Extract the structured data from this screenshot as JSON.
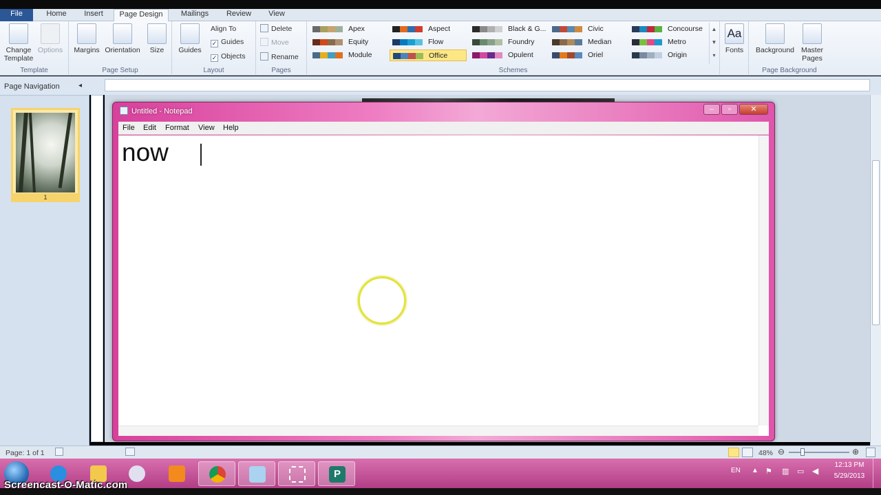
{
  "ribbon_tabs": [
    "File",
    "Home",
    "Insert",
    "Page Design",
    "Mailings",
    "Review",
    "View"
  ],
  "ribbon": {
    "template": {
      "change_template": "Change Template",
      "options": "Options",
      "label": "Template"
    },
    "page_setup": {
      "margins": "Margins",
      "orientation": "Orientation",
      "size": "Size",
      "label": "Page Setup"
    },
    "layout": {
      "guides": "Guides",
      "align_to": "Align To",
      "guides_check": "Guides",
      "objects_check": "Objects",
      "label": "Layout"
    },
    "pages": {
      "delete": "Delete",
      "move": "Move",
      "rename": "Rename",
      "label": "Pages"
    },
    "schemes": {
      "label": "Schemes",
      "items": [
        {
          "name": "Apex",
          "colors": [
            "#6a6a6a",
            "#a8a060",
            "#c9a36b",
            "#9fb09a"
          ]
        },
        {
          "name": "Aspect",
          "colors": [
            "#222222",
            "#e06a1f",
            "#2a6fb0",
            "#d33b2c"
          ]
        },
        {
          "name": "Black & G...",
          "colors": [
            "#2a2a2a",
            "#8a8a8a",
            "#b0b0b0",
            "#d0d0d0"
          ]
        },
        {
          "name": "Civic",
          "colors": [
            "#4a6a8a",
            "#c04a3a",
            "#5a8ab0",
            "#d08a40"
          ]
        },
        {
          "name": "Concourse",
          "colors": [
            "#2a3a5a",
            "#1a8ac0",
            "#c02a3a",
            "#5ab040"
          ]
        },
        {
          "name": "Equity",
          "colors": [
            "#6a2a1a",
            "#d04a1a",
            "#8a6a4a",
            "#b09070"
          ]
        },
        {
          "name": "Flow",
          "colors": [
            "#1a3a6a",
            "#0a7ac0",
            "#1aa0d0",
            "#5ac0e0"
          ]
        },
        {
          "name": "Foundry",
          "colors": [
            "#3a4a3a",
            "#6a8a6a",
            "#8aa08a",
            "#b0c0a0"
          ]
        },
        {
          "name": "Median",
          "colors": [
            "#4a3a2a",
            "#8a6a4a",
            "#b08a5a",
            "#5a7a9a"
          ]
        },
        {
          "name": "Metro",
          "colors": [
            "#2a2a3a",
            "#7ac040",
            "#e04a8a",
            "#1a9ad0"
          ]
        },
        {
          "name": "Module",
          "colors": [
            "#4a6a8a",
            "#e0b020",
            "#40a0c0",
            "#e07020"
          ]
        },
        {
          "name": "Office",
          "colors": [
            "#1f497d",
            "#4f81bd",
            "#c0504d",
            "#9bbb59"
          ]
        },
        {
          "name": "Opulent",
          "colors": [
            "#8a1a6a",
            "#d04aa0",
            "#6a2a8a",
            "#e08ac0"
          ]
        },
        {
          "name": "Oriel",
          "colors": [
            "#3a4a6a",
            "#e07a20",
            "#a04a2a",
            "#5a8ac0"
          ]
        },
        {
          "name": "Origin",
          "colors": [
            "#2a3a4a",
            "#7a8aa0",
            "#a0b0c0",
            "#c0d0e0"
          ]
        }
      ],
      "selected": "Office"
    },
    "fonts": {
      "label": "Fonts",
      "glyph": "Aa"
    },
    "page_background": {
      "background": "Background",
      "master_pages": "Master Pages",
      "label": "Page Background"
    }
  },
  "nav_pane": {
    "title": "Page Navigation",
    "page_number": "1"
  },
  "notepad": {
    "title": "Untitled - Notepad",
    "menu": [
      "File",
      "Edit",
      "Format",
      "View",
      "Help"
    ],
    "content": "now"
  },
  "status": {
    "page": "Page: 1 of 1",
    "zoom": "48%"
  },
  "tray": {
    "lang": "EN",
    "time": "12:13 PM",
    "date": "5/29/2013"
  },
  "watermark": "Screencast-O-Matic.com",
  "colors": {
    "taskbar": "#c24d97",
    "notepad_frame": "#e45aaf",
    "ribbon_file": "#2b5797",
    "selected_scheme": "#fde785"
  }
}
